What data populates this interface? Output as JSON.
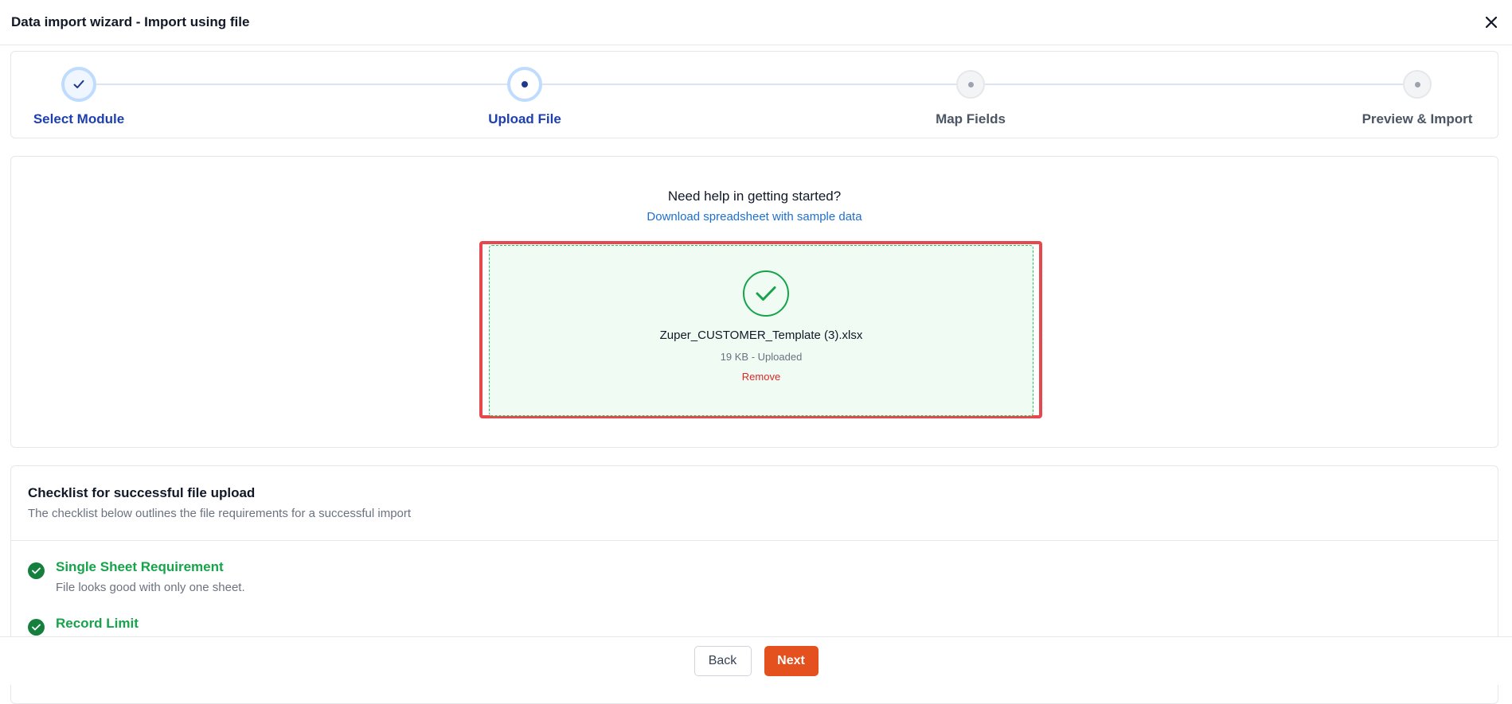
{
  "header": {
    "title": "Data import wizard - Import using file",
    "close_icon": "close-icon"
  },
  "stepper": {
    "steps": [
      {
        "label": "Select Module",
        "state": "completed"
      },
      {
        "label": "Upload File",
        "state": "active"
      },
      {
        "label": "Map Fields",
        "state": "pending"
      },
      {
        "label": "Preview & Import",
        "state": "pending"
      }
    ]
  },
  "upload": {
    "help_title": "Need help in getting started?",
    "help_link": "Download spreadsheet with sample data",
    "file_name": "Zuper_CUSTOMER_Template (3).xlsx",
    "file_meta": "19 KB - Uploaded",
    "remove_label": "Remove",
    "success_icon": "check-circle-icon"
  },
  "checklist": {
    "title": "Checklist for successful file upload",
    "subtitle": "The checklist below outlines the file requirements for a successful import",
    "items": [
      {
        "title": "Single Sheet Requirement",
        "description": "File looks good with only one sheet."
      },
      {
        "title": "Record Limit",
        "description": ""
      }
    ]
  },
  "footer": {
    "back_label": "Back",
    "next_label": "Next"
  },
  "colors": {
    "accent_blue": "#1e40af",
    "link_blue": "#1d6fd1",
    "success_green": "#16a34a",
    "danger_red": "#dc2626",
    "primary_orange": "#e4501e",
    "highlight_red": "#e5484d"
  }
}
